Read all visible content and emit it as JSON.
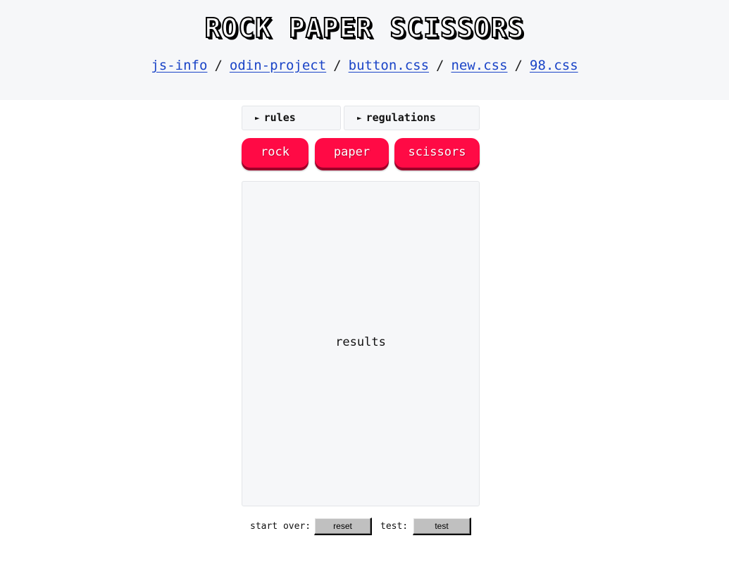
{
  "header": {
    "title": "ROCK PAPER SCISSORS",
    "links": [
      "js-info",
      "odin-project",
      "button.css",
      "new.css",
      "98.css"
    ],
    "separator": "/"
  },
  "details": {
    "rules": "rules",
    "regulations": "regulations",
    "arrow": "►"
  },
  "choices": {
    "rock": "rock",
    "paper": "paper",
    "scissors": "scissors"
  },
  "results": {
    "text": "results"
  },
  "footer": {
    "start_over_label": "start over:",
    "reset_label": "reset",
    "test_label": "test:",
    "test_button_label": "test"
  },
  "colors": {
    "header_bg": "#f6f7f9",
    "link": "#1a44c7",
    "choice_button": "#ff0a45",
    "choice_button_shadow": "#9b0029",
    "w98_button": "#c0c0c0"
  }
}
